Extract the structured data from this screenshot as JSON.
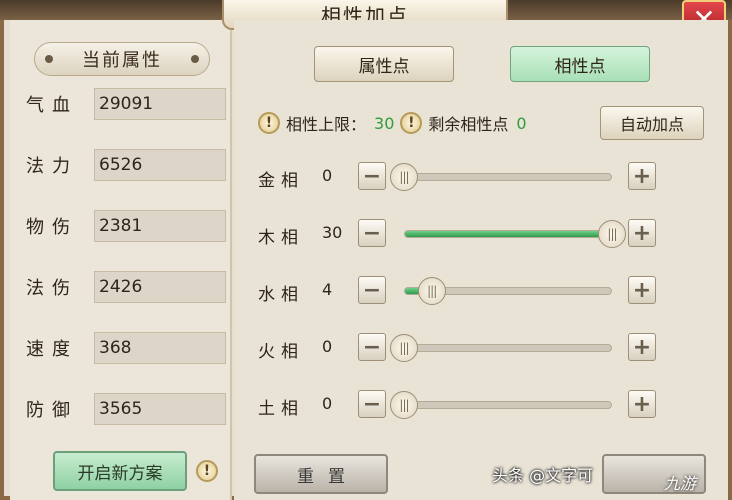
{
  "window": {
    "title": "相性加点",
    "close_symbol": "✕"
  },
  "left_panel": {
    "section_title": "当前属性",
    "attributes": [
      {
        "label": "气血",
        "value": "29091"
      },
      {
        "label": "法力",
        "value": "6526"
      },
      {
        "label": "物伤",
        "value": "2381"
      },
      {
        "label": "法伤",
        "value": "2426"
      },
      {
        "label": "速度",
        "value": "368"
      },
      {
        "label": "防御",
        "value": "3565"
      }
    ],
    "open_plan_button": "开启新方案"
  },
  "tabs": {
    "attribute_points": "属性点",
    "affinity_points": "相性点",
    "active": "相性点"
  },
  "limits": {
    "cap_label": "相性上限：",
    "cap_value": "30",
    "remaining_label": "剩余相性点",
    "remaining_value": "0"
  },
  "auto_button": "自动加点",
  "sliders": [
    {
      "label": "金相",
      "value": "0",
      "max": 30
    },
    {
      "label": "木相",
      "value": "30",
      "max": 30
    },
    {
      "label": "水相",
      "value": "4",
      "max": 30
    },
    {
      "label": "火相",
      "value": "0",
      "max": 30
    },
    {
      "label": "土相",
      "value": "0",
      "max": 30
    }
  ],
  "reset_button": "重置",
  "watermark": "头条 @文字可",
  "watermark_logo": "九游",
  "colors": {
    "accent_green": "#2f9c3c",
    "close_red": "#c0282c",
    "panel_bg": "#e9e3d6"
  }
}
